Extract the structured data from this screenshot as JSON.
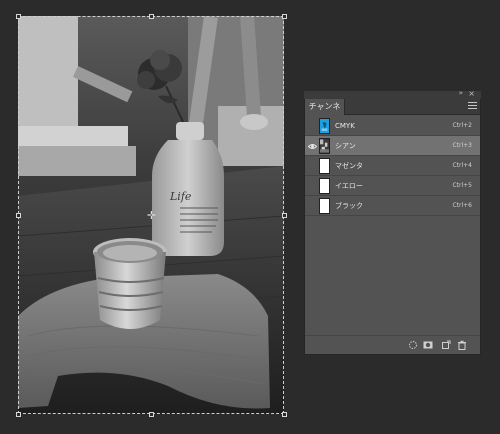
{
  "panel": {
    "tab_label": "チャンネル",
    "collapse_glyph": "»",
    "close_glyph": "×"
  },
  "channels": [
    {
      "name": "CMYK",
      "shortcut": "Ctrl+2",
      "visible": false,
      "selected": false,
      "thumb": "cmyk"
    },
    {
      "name": "シアン",
      "shortcut": "Ctrl+3",
      "visible": true,
      "selected": true,
      "thumb": "image"
    },
    {
      "name": "マゼンタ",
      "shortcut": "Ctrl+4",
      "visible": false,
      "selected": false,
      "thumb": "blank"
    },
    {
      "name": "イエロー",
      "shortcut": "Ctrl+5",
      "visible": false,
      "selected": false,
      "thumb": "blank"
    },
    {
      "name": "ブラック",
      "shortcut": "Ctrl+6",
      "visible": false,
      "selected": false,
      "thumb": "blank"
    }
  ],
  "icons": {
    "eye": "eye-icon",
    "load_selection": "load-channel-as-selection-icon",
    "save_selection": "save-selection-as-channel-icon",
    "new_channel": "new-channel-icon",
    "delete": "trash-icon",
    "panel_menu": "panel-menu-icon"
  },
  "image": {
    "vase_text": "Life"
  },
  "colors": {
    "workspace_bg": "#2b2b2b",
    "panel_bg": "#535353",
    "selected_row": "#727272",
    "cmyk_thumb": "#1ea0e0"
  }
}
